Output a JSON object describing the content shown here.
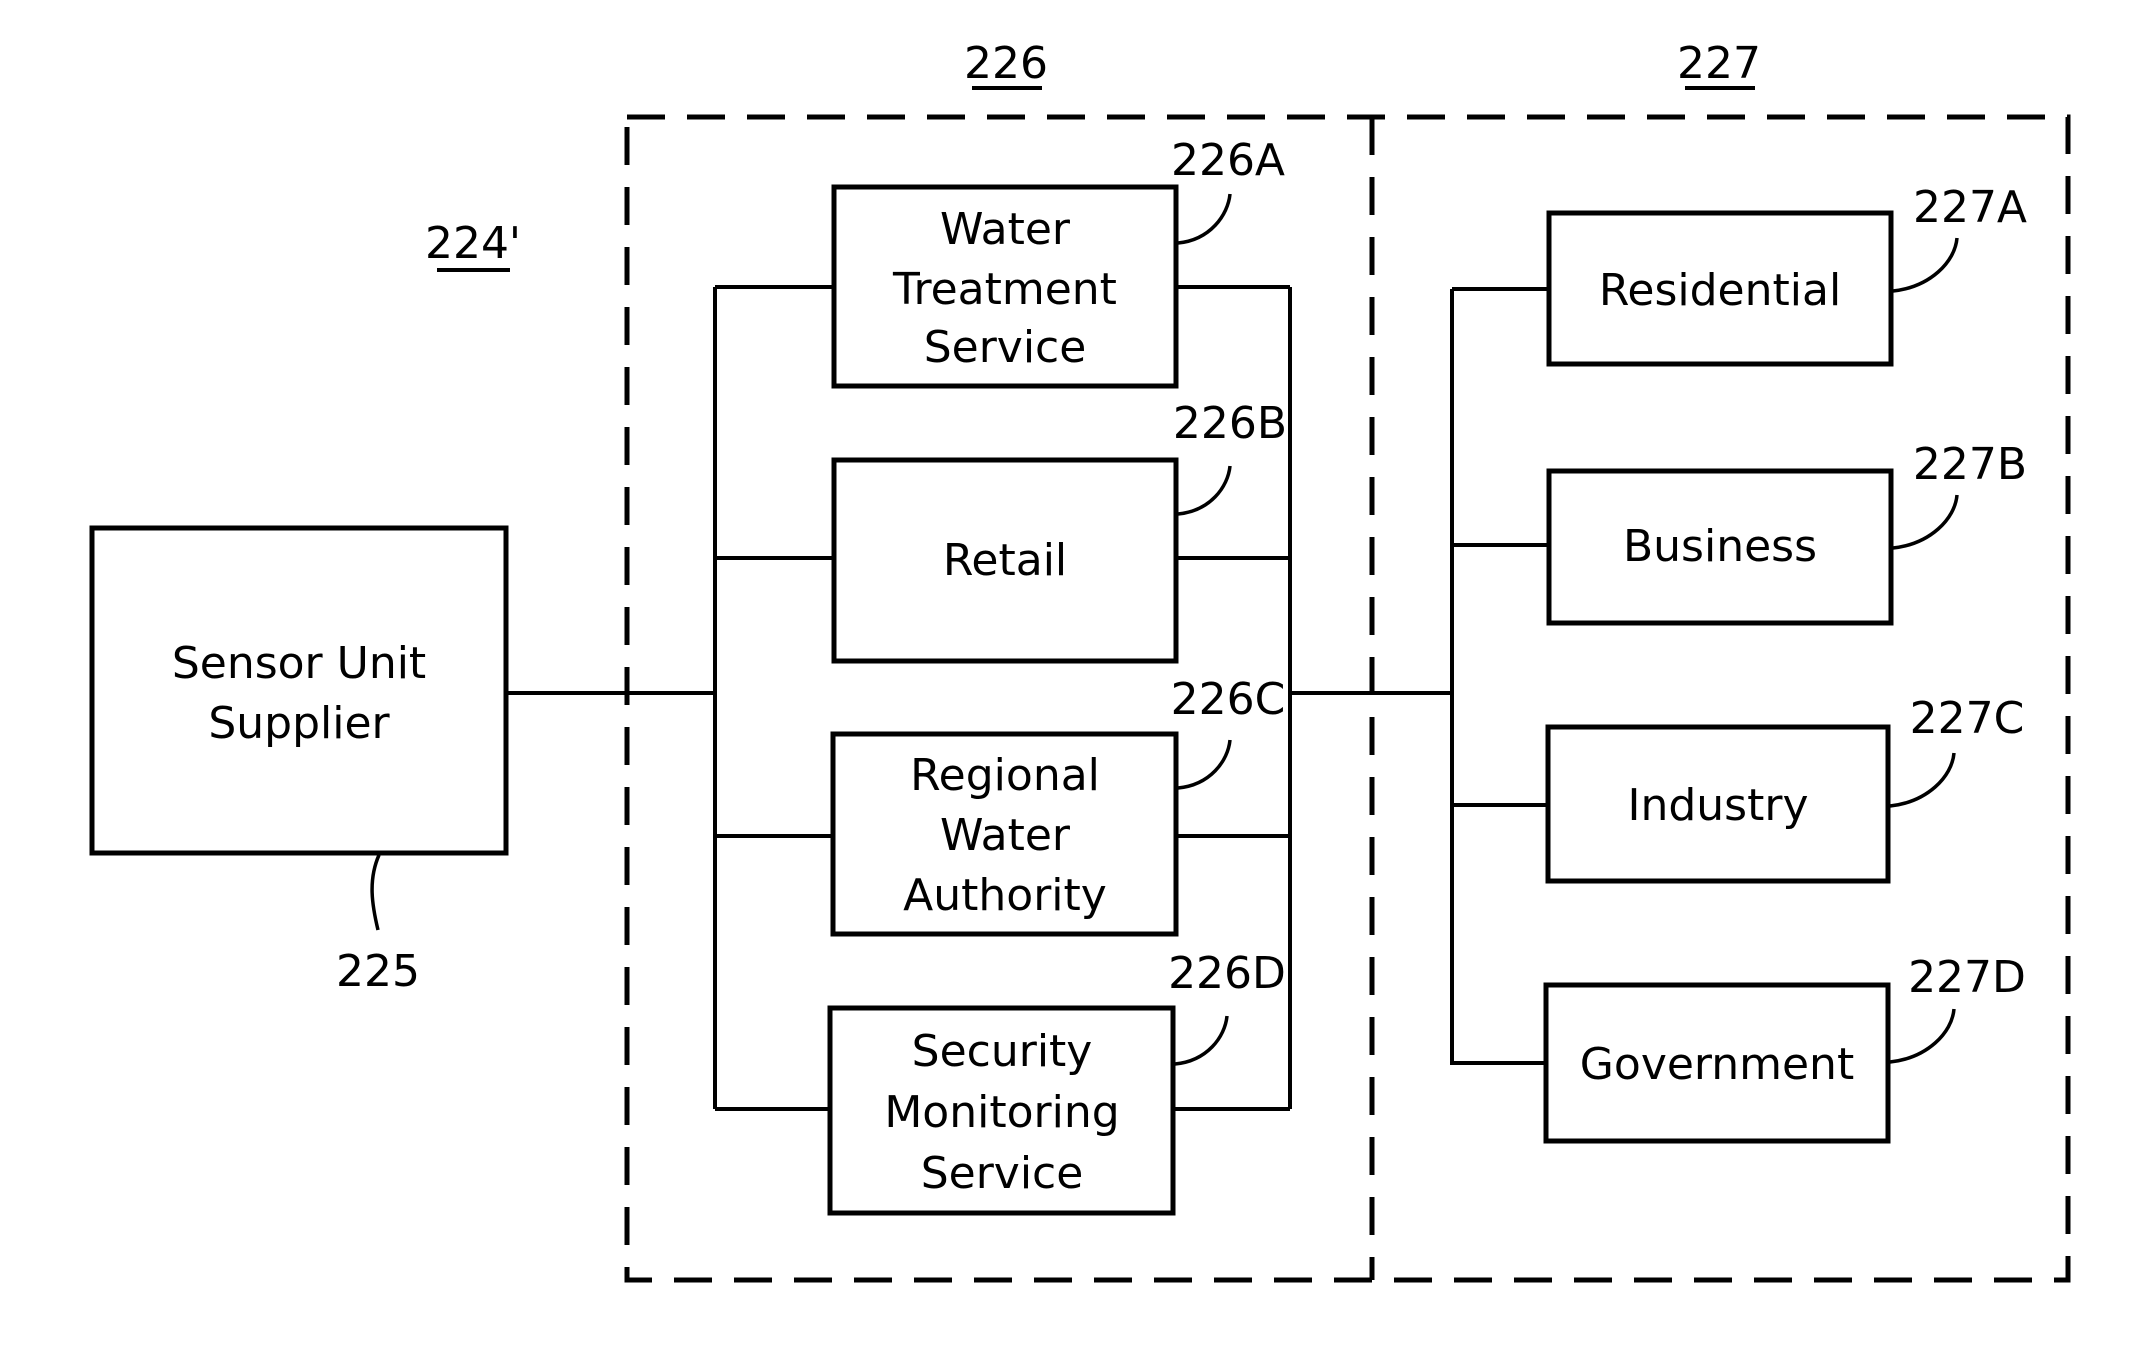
{
  "diagram": {
    "group_labels": {
      "system": "224'",
      "service_providers": "226",
      "end_users": "227"
    },
    "supplier": {
      "ref": "225",
      "lines": [
        "Sensor Unit",
        "Supplier"
      ]
    },
    "providers": [
      {
        "ref": "226A",
        "lines": [
          "Water",
          "Treatment",
          "Service"
        ]
      },
      {
        "ref": "226B",
        "lines": [
          "Retail"
        ]
      },
      {
        "ref": "226C",
        "lines": [
          "Regional",
          "Water",
          "Authority"
        ]
      },
      {
        "ref": "226D",
        "lines": [
          "Security",
          "Monitoring",
          "Service"
        ]
      }
    ],
    "customers": [
      {
        "ref": "227A",
        "lines": [
          "Residential"
        ]
      },
      {
        "ref": "227B",
        "lines": [
          "Business"
        ]
      },
      {
        "ref": "227C",
        "lines": [
          "Industry"
        ]
      },
      {
        "ref": "227D",
        "lines": [
          "Government"
        ]
      }
    ],
    "connections": [
      {
        "from": "225",
        "to": "226"
      },
      {
        "from": "226",
        "to": "226A"
      },
      {
        "from": "226",
        "to": "226B"
      },
      {
        "from": "226",
        "to": "226C"
      },
      {
        "from": "226",
        "to": "226D"
      },
      {
        "from": "226",
        "to": "227"
      },
      {
        "from": "227",
        "to": "227A"
      },
      {
        "from": "227",
        "to": "227B"
      },
      {
        "from": "227",
        "to": "227C"
      },
      {
        "from": "227",
        "to": "227D"
      }
    ]
  }
}
